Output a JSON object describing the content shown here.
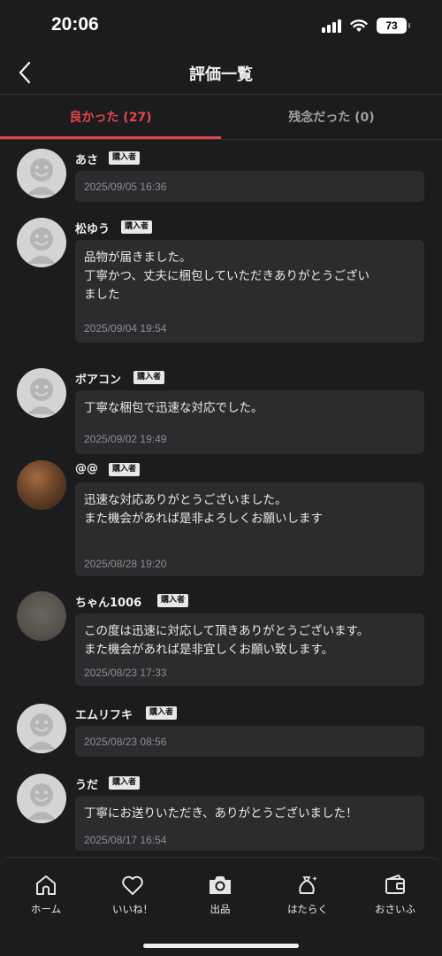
{
  "status_bar": {
    "time": "20:06",
    "battery": "73"
  },
  "header": {
    "title": "評価一覧"
  },
  "tabs": [
    {
      "label": "良かった (27)",
      "active": true
    },
    {
      "label": "残念だった (0)",
      "active": false
    }
  ],
  "reviews": [
    {
      "user": "あさ",
      "badge": "購入者",
      "comment": "",
      "date": "2025/09/05 16:36"
    },
    {
      "user": "松ゆう",
      "badge": "購入者",
      "comment": "品物が届きました。\n丁寧かつ、丈夫に梱包していただきありがとうござい\nました",
      "date": "2025/09/04 19:54"
    },
    {
      "user": "ボアコン",
      "badge": "購入者",
      "comment": "丁寧な梱包で迅速な対応でした。",
      "date": "2025/09/02 19:49"
    },
    {
      "user": "@@",
      "badge": "購入者",
      "comment": "迅速な対応ありがとうございました。\nまた機会があれば是非よろしくお願いします",
      "date": "2025/08/28 19:20"
    },
    {
      "user": "ちゃん1006",
      "badge": "購入者",
      "comment": "この度は迅速に対応して頂きありがとうございます。\nまた機会があれば是非宜しくお願い致します。",
      "date": "2025/08/23 17:33"
    },
    {
      "user": "エムリフキ",
      "badge": "購入者",
      "comment": "",
      "date": "2025/08/23 08:56"
    },
    {
      "user": "うだ",
      "badge": "購入者",
      "comment": "丁寧にお送りいただき、ありがとうございました！",
      "date": "2025/08/17 16:54"
    }
  ],
  "bottom_nav": [
    {
      "label": "ホーム",
      "icon": "home-icon"
    },
    {
      "label": "いいね！",
      "icon": "heart-icon"
    },
    {
      "label": "出品",
      "icon": "camera-icon"
    },
    {
      "label": "はたらく",
      "icon": "money-bag-icon"
    },
    {
      "label": "おさいふ",
      "icon": "wallet-icon"
    }
  ],
  "colors": {
    "accent": "#e6454b",
    "background": "#1c1c1e",
    "bubble": "#2c2c2e"
  }
}
